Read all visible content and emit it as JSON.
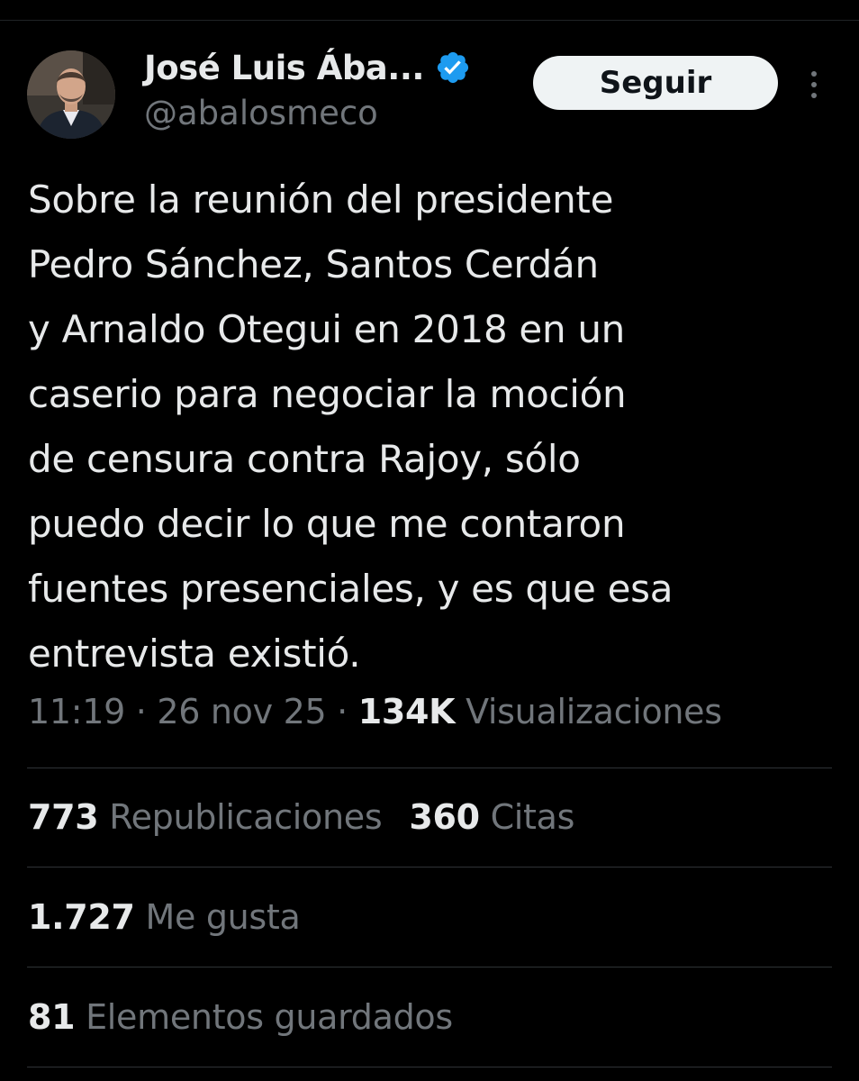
{
  "author": {
    "display_name": "José Luis Ába...",
    "handle": "@abalosmeco",
    "verified_color": "#1d9bf0"
  },
  "actions": {
    "follow_label": "Seguir"
  },
  "tweet": {
    "lines": [
      "Sobre la reunión del presidente",
      "Pedro Sánchez, Santos Cerdán",
      "y Arnaldo Otegui en 2018 en un",
      "caserio para negociar la moción",
      "de censura contra Rajoy, sólo",
      "puedo decir lo que me contaron",
      "fuentes presenciales, y es que esa",
      "entrevista existió."
    ]
  },
  "meta": {
    "time": "11:19",
    "separator": "·",
    "date": "26 nov 25",
    "views_count": "134K",
    "views_label": "Visualizaciones"
  },
  "stats": {
    "reposts_count": "773",
    "reposts_label": "Republicaciones",
    "quotes_count": "360",
    "quotes_label": "Citas",
    "likes_count": "1.727",
    "likes_label": "Me gusta",
    "bookmarks_count": "81",
    "bookmarks_label": "Elementos guardados"
  }
}
